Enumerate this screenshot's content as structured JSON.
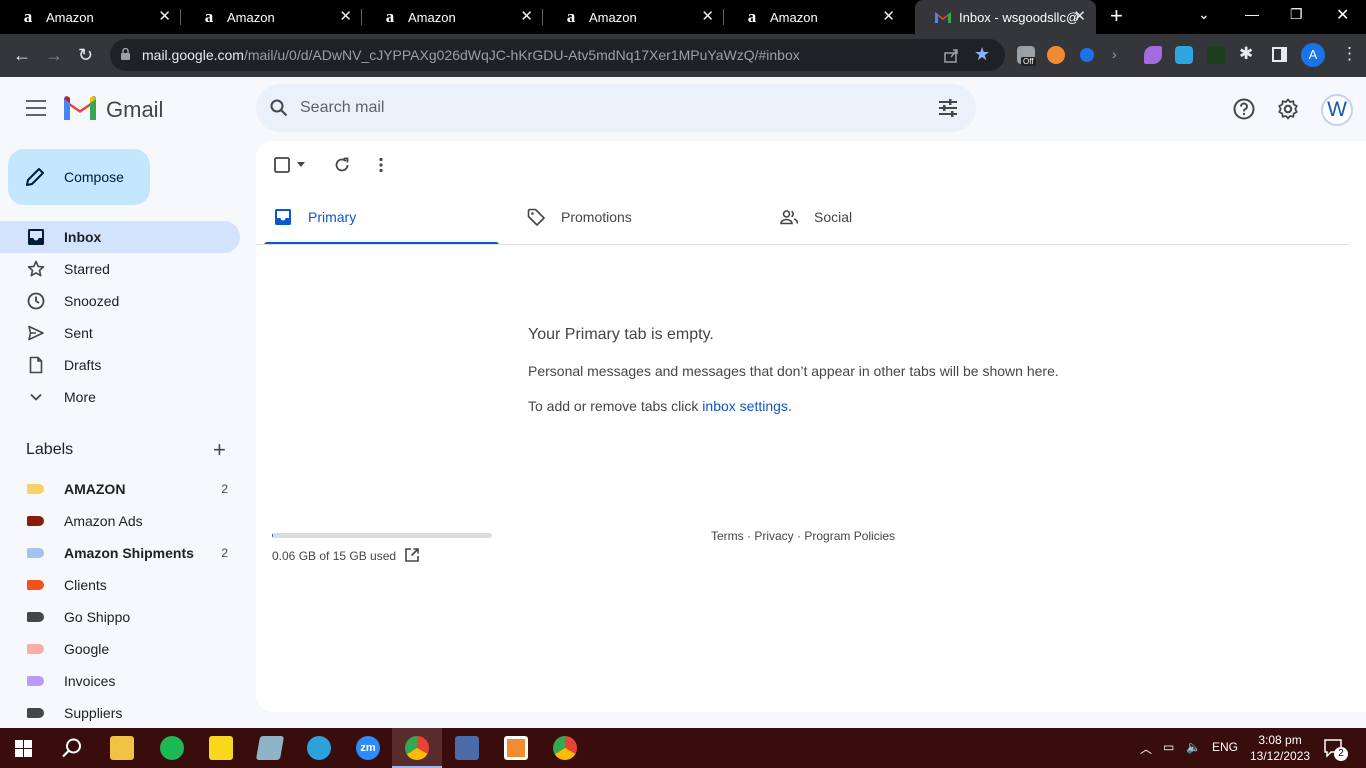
{
  "browser": {
    "tabs": [
      {
        "title": "Amazon",
        "favicon": "amazon-icon"
      },
      {
        "title": "Amazon",
        "favicon": "amazon-icon"
      },
      {
        "title": "Amazon",
        "favicon": "amazon-icon"
      },
      {
        "title": "Amazon",
        "favicon": "amazon-icon"
      },
      {
        "title": "Amazon",
        "favicon": "amazon-icon"
      },
      {
        "title": "Inbox - wsgoodsllc@",
        "favicon": "gmail-icon",
        "active": true
      }
    ],
    "url_host": "mail.google.com",
    "url_path": "/mail/u/0/d/ADwNV_cJYPPAXg026dWqJC-hKrGDU-Atv5mdNq17Xer1MPuYaWzQ/#inbox",
    "extension_off_badge": "Off",
    "profile_initial": "A"
  },
  "gmail": {
    "brand": "Gmail",
    "search_placeholder": "Search mail",
    "avatar_letter": "W",
    "compose_label": "Compose",
    "nav": [
      {
        "label": "Inbox",
        "icon": "inbox-icon",
        "active": true
      },
      {
        "label": "Starred",
        "icon": "star-icon"
      },
      {
        "label": "Snoozed",
        "icon": "clock-icon"
      },
      {
        "label": "Sent",
        "icon": "send-icon"
      },
      {
        "label": "Drafts",
        "icon": "draft-icon"
      },
      {
        "label": "More",
        "icon": "chevron-down-icon"
      }
    ],
    "labels_heading": "Labels",
    "labels": [
      {
        "label": "AMAZON",
        "color": "#fad165",
        "count": "2",
        "bold": true
      },
      {
        "label": "Amazon Ads",
        "color": "#8a1c0a",
        "count": ""
      },
      {
        "label": "Amazon Shipments",
        "color": "#a4c2f4",
        "count": "2",
        "bold": true
      },
      {
        "label": "Clients",
        "color": "#f4511e",
        "count": ""
      },
      {
        "label": "Go Shippo",
        "color": "#444746",
        "count": ""
      },
      {
        "label": "Google",
        "color": "#f6aea9",
        "count": ""
      },
      {
        "label": "Invoices",
        "color": "#b99aff",
        "count": ""
      },
      {
        "label": "Suppliers",
        "color": "#444746",
        "count": ""
      }
    ],
    "category_tabs": [
      {
        "label": "Primary",
        "icon": "inbox-icon",
        "active": true
      },
      {
        "label": "Promotions",
        "icon": "tag-icon"
      },
      {
        "label": "Social",
        "icon": "people-icon"
      }
    ],
    "empty_title": "Your Primary tab is empty.",
    "empty_description": "Personal messages and messages that don’t appear in other tabs will be shown here.",
    "empty_hint_prefix": "To add or remove tabs click ",
    "empty_hint_link": "inbox settings",
    "empty_hint_suffix": ".",
    "storage_text": "0.06 GB of 15 GB used",
    "storage_used_fraction": 0.004,
    "footer": {
      "terms": "Terms",
      "privacy": "Privacy",
      "policies": "Program Policies",
      "sep": " · "
    }
  },
  "taskbar": {
    "language": "ENG",
    "time": "3:08 pm",
    "date": "13/12/2023",
    "notification_count": "2",
    "zoom_label": "zm"
  },
  "colors": {
    "accent": "#0b57d0",
    "compose_bg": "#c2e7ff",
    "nav_active_bg": "#d3e3fd"
  }
}
